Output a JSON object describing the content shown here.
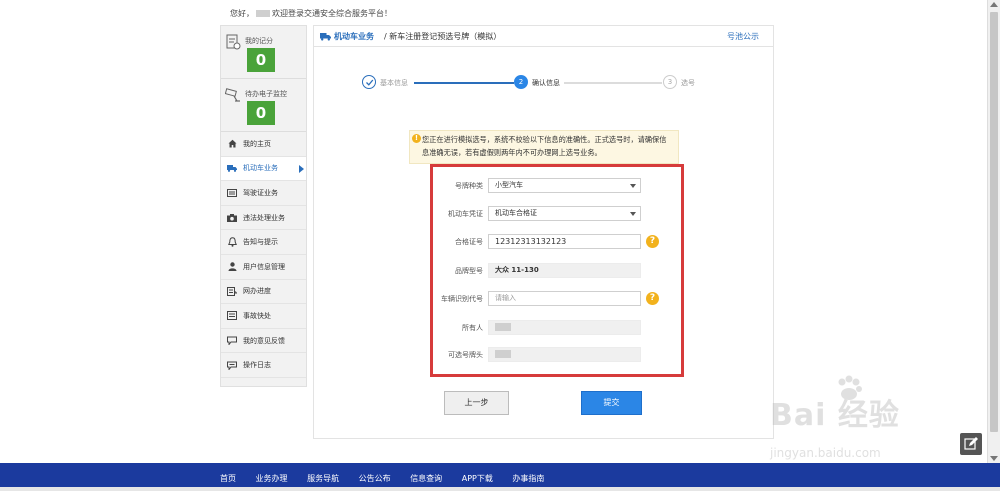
{
  "topbar": {
    "greeting": "您好，",
    "welcome": "欢迎登录交通安全综合服务平台！"
  },
  "sidebar": {
    "score_label": "我的记分",
    "score_value": "0",
    "violations_label": "待办电子监控",
    "violations_value": "0",
    "items": [
      {
        "label": "我的主页",
        "icon": "home-icon"
      },
      {
        "label": "机动车业务",
        "icon": "truck-icon",
        "active": true
      },
      {
        "label": "驾驶证业务",
        "icon": "license-card-icon"
      },
      {
        "label": "违法处理业务",
        "icon": "camera-icon"
      },
      {
        "label": "告知与提示",
        "icon": "bell-icon"
      },
      {
        "label": "用户信息管理",
        "icon": "user-icon"
      },
      {
        "label": "网办进度",
        "icon": "progress-icon"
      },
      {
        "label": "事故快处",
        "icon": "accident-icon"
      },
      {
        "label": "我的意见反馈",
        "icon": "feedback-icon"
      },
      {
        "label": "操作日志",
        "icon": "log-icon"
      }
    ]
  },
  "main": {
    "section": "机动车业务",
    "breadcrumb": "/ 新车注册登记预选号牌（模拟）",
    "link": "号池公示"
  },
  "steps": [
    {
      "num": "",
      "label": "基本信息",
      "state": "done"
    },
    {
      "num": "2",
      "label": "确认信息",
      "state": "active"
    },
    {
      "num": "3",
      "label": "选号",
      "state": "pending"
    }
  ],
  "notice": "您正在进行模拟选号，系统不校验以下信息的准确性。正式选号时，请确保信息准确无误，若有虚假则两年内不可办理网上选号业务。",
  "form": {
    "plate_type_label": "号牌种类",
    "plate_type_value": "小型汽车",
    "vehicle_doc_label": "机动车凭证",
    "vehicle_doc_value": "机动车合格证",
    "cert_no_label": "合格证号",
    "cert_no_value": "12312313132123",
    "model_label": "品牌型号",
    "model_value": "大众 11-130",
    "vin_label": "车辆识别代号",
    "vin_placeholder": "请输入",
    "owner_label": "所有人",
    "plate_prefix_label": "可选号牌头"
  },
  "buttons": {
    "back": "上一步",
    "submit": "提交"
  },
  "footer": {
    "nav": [
      "首页",
      "业务办理",
      "服务导航",
      "公告公布",
      "信息查询",
      "APP下载",
      "办事指南"
    ]
  },
  "watermark": {
    "text": "Bai 经验",
    "url": "jingyan.baidu.com"
  },
  "colors": {
    "accent": "#2a6ebb",
    "score_green": "#4aa33a",
    "highlight_red": "#d63b3b",
    "footer_blue": "#1b3a9e",
    "warning": "#f2b21d"
  }
}
